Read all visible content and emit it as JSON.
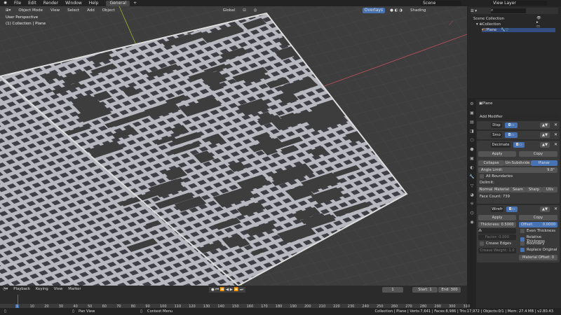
{
  "topbar": {
    "menus": [
      "File",
      "Edit",
      "Render",
      "Window",
      "Help"
    ],
    "workspace_tab": "General",
    "add_tab": "+",
    "scene": "Scene",
    "view_layer": "View Layer"
  },
  "viewport": {
    "mode": "Object Mode",
    "menus": [
      "View",
      "Select",
      "Add",
      "Object"
    ],
    "orientation": "Global",
    "overlays": "Overlays",
    "shading": "Shading",
    "view_name": "User Perspective",
    "context": "(1) Collection | Plane"
  },
  "outliner": {
    "root": "Scene Collection",
    "collection": "Collection",
    "object": "Plane"
  },
  "properties": {
    "object_name": "Plane",
    "add_modifier": "Add Modifier",
    "modifiers": [
      {
        "name": "Disp"
      },
      {
        "name": "Smo"
      },
      {
        "name": "Decimate"
      },
      {
        "name": "Wirefr"
      }
    ],
    "decimate": {
      "apply": "Apply",
      "copy": "Copy",
      "modes": [
        "Collapse",
        "Un-Subdivide",
        "Planar"
      ],
      "active_mode": "Planar",
      "angle_label": "Angle Limit:",
      "angle_value": "9.8°",
      "all_boundaries": "All Boundaries",
      "delimit_label": "Delimit:",
      "delimit": [
        "Normal",
        "Material",
        "Seam",
        "Sharp",
        "UVs"
      ],
      "face_count": "Face Count: 739"
    },
    "wireframe": {
      "apply": "Apply",
      "copy": "Copy",
      "thickness": "Thickness: 0.5000",
      "offset_label": "Offset:",
      "offset_value": "0.0000",
      "even_thickness": "Even Thickness",
      "relative_thickness": "Relative Thickness",
      "boundary": "Boundary",
      "replace_original": "Replace Original",
      "factor_label": "Factor:",
      "factor_value": "0.000",
      "crease_edges": "Crease Edges",
      "crease_weight": "Crease Weight: 1.0",
      "material_offset": "Material Offset:",
      "material_offset_value": "0"
    }
  },
  "timeline": {
    "menus": [
      "Playback",
      "Keying",
      "View",
      "Marker"
    ],
    "current_frame": "1",
    "start_label": "Start:",
    "start": "1",
    "end_label": "End:",
    "end": "300",
    "ticks": [
      "1",
      "10",
      "20",
      "30",
      "40",
      "50",
      "60",
      "70",
      "80",
      "90",
      "100",
      "110",
      "120",
      "130",
      "140",
      "150",
      "160",
      "170",
      "180",
      "190",
      "200",
      "210",
      "220",
      "230",
      "240",
      "250",
      "260",
      "270",
      "280",
      "290",
      "300",
      "310"
    ]
  },
  "status": {
    "pan": "Pan View",
    "context_menu": "Context Menu",
    "stats": "Collection | Plane | Verts:7,641 | Faces:8,986 | Tris:17,972 | Objects:0/1 | Mem: 27.4 MB | v2.80.43"
  },
  "colors": {
    "accent": "#4772b3",
    "x_axis": "#c0505a",
    "y_axis": "#9bb536"
  }
}
